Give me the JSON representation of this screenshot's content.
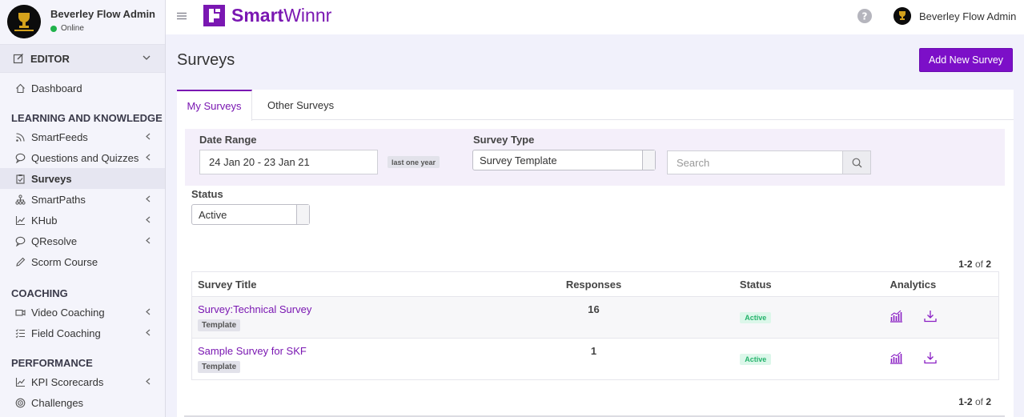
{
  "sidebar": {
    "user_name": "Beverley Flow Admin",
    "user_status": "Online",
    "editor_label": "EDITOR",
    "items_top": [
      {
        "label": "Dashboard",
        "icon": "home-icon"
      }
    ],
    "sections": [
      {
        "title": "LEARNING AND KNOWLEDGE",
        "items": [
          {
            "label": "SmartFeeds",
            "icon": "feed-icon",
            "expandable": true
          },
          {
            "label": "Questions and Quizzes",
            "icon": "chat-icon",
            "expandable": true
          },
          {
            "label": "Surveys",
            "icon": "clipboard-icon",
            "expandable": false,
            "active": true
          },
          {
            "label": "SmartPaths",
            "icon": "sitemap-icon",
            "expandable": true
          },
          {
            "label": "KHub",
            "icon": "chart-line-icon",
            "expandable": true
          },
          {
            "label": "QResolve",
            "icon": "chat-icon",
            "expandable": true
          },
          {
            "label": "Scorm Course",
            "icon": "pencil-icon",
            "expandable": false
          }
        ]
      },
      {
        "title": "COACHING",
        "items": [
          {
            "label": "Video Coaching",
            "icon": "video-icon",
            "expandable": true
          },
          {
            "label": "Field Coaching",
            "icon": "list-check-icon",
            "expandable": true
          }
        ]
      },
      {
        "title": "PERFORMANCE",
        "items": [
          {
            "label": "KPI Scorecards",
            "icon": "chart-line-icon",
            "expandable": true
          },
          {
            "label": "Challenges",
            "icon": "target-icon",
            "expandable": false
          }
        ]
      }
    ]
  },
  "topbar": {
    "brand": "SmartWinnr",
    "brand_bold": "Smart",
    "brand_light": "Winnr",
    "user_name": "Beverley Flow Admin"
  },
  "page": {
    "title": "Surveys",
    "add_button": "Add New Survey"
  },
  "tabs": [
    {
      "label": "My Surveys",
      "active": true
    },
    {
      "label": "Other Surveys",
      "active": false
    }
  ],
  "filters": {
    "date_range_label": "Date Range",
    "date_range_value": "24 Jan 20 - 23 Jan 21",
    "date_range_hint": "last one year",
    "survey_type_label": "Survey Type",
    "survey_type_value": "Survey Template",
    "search_placeholder": "Search",
    "status_label": "Status",
    "status_value": "Active"
  },
  "pager": {
    "range": "1-2",
    "of_label": "of",
    "total": "2"
  },
  "table": {
    "headers": [
      "Survey Title",
      "Responses",
      "Status",
      "Analytics"
    ],
    "rows": [
      {
        "title": "Survey:Technical Survey",
        "tag": "Template",
        "responses": "16",
        "status": "Active"
      },
      {
        "title": "Sample Survey for SKF",
        "tag": "Template",
        "responses": "1",
        "status": "Active"
      }
    ]
  },
  "colors": {
    "brand": "#7a17b2",
    "button": "#7c0fc8",
    "active_badge": "#24b36b"
  }
}
